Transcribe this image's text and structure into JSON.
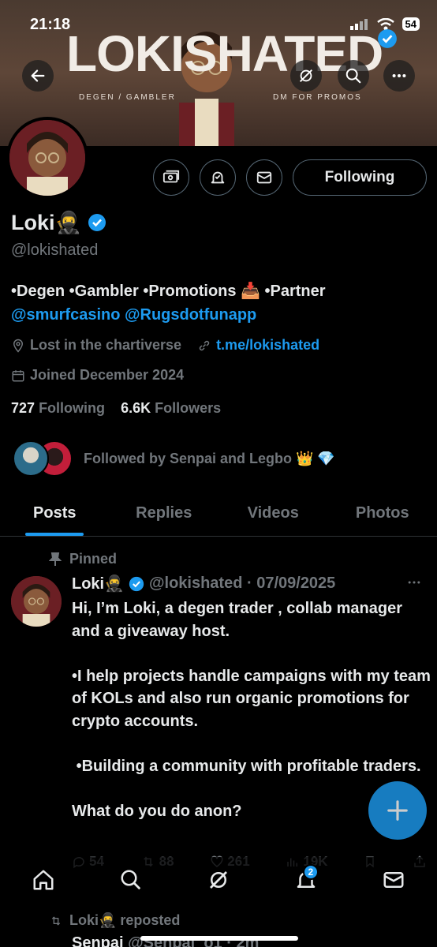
{
  "status_bar": {
    "time": "21:18",
    "battery": "54"
  },
  "banner": {
    "title": "LOKISHATED",
    "left_sub": "DEGEN / GAMBLER",
    "right_sub": "DM FOR PROMOS"
  },
  "profile": {
    "name": "Loki",
    "name_emoji": "🥷",
    "handle": "@lokishated",
    "bio_line": "•Degen •Gambler •Promotions 📥 •Partner",
    "bio_links": [
      "@smurfcasino",
      "@Rugsdotfunapp"
    ],
    "location": "Lost in the chartiverse",
    "website": "t.me/lokishated",
    "joined": "Joined December 2024",
    "following_count": "727",
    "following_label": "Following",
    "followers_count": "6.6K",
    "followers_label": "Followers",
    "followed_by": "Followed by Senpai and Legbo 👑 💎",
    "follow_button": "Following"
  },
  "tabs": [
    {
      "label": "Posts",
      "active": true
    },
    {
      "label": "Replies"
    },
    {
      "label": "Videos"
    },
    {
      "label": "Photos"
    }
  ],
  "pinned_post": {
    "pinned_label": "Pinned",
    "author": "Loki🥷",
    "handle_date": "@lokishated · 07/09/2025",
    "body": "Hi, I’m Loki, a degen trader , collab manager and a giveaway host.\n\n•I help projects handle campaigns with my team of KOLs and also run organic promotions for crypto accounts.\n\n •Building a community with profitable traders.\n\nWhat do you do anon?",
    "replies": "54",
    "reposts": "88",
    "likes": "261",
    "views": "19K"
  },
  "nav": {
    "notifications_badge": "2"
  },
  "next_post": {
    "repost_label": "Loki🥷 reposted",
    "author": "Senpai",
    "handle_time": "@Senpai_o1 · 2m"
  },
  "colors": {
    "accent": "#1d9bf0",
    "muted": "#71767b",
    "text": "#e7e9ea",
    "background": "#000000"
  }
}
